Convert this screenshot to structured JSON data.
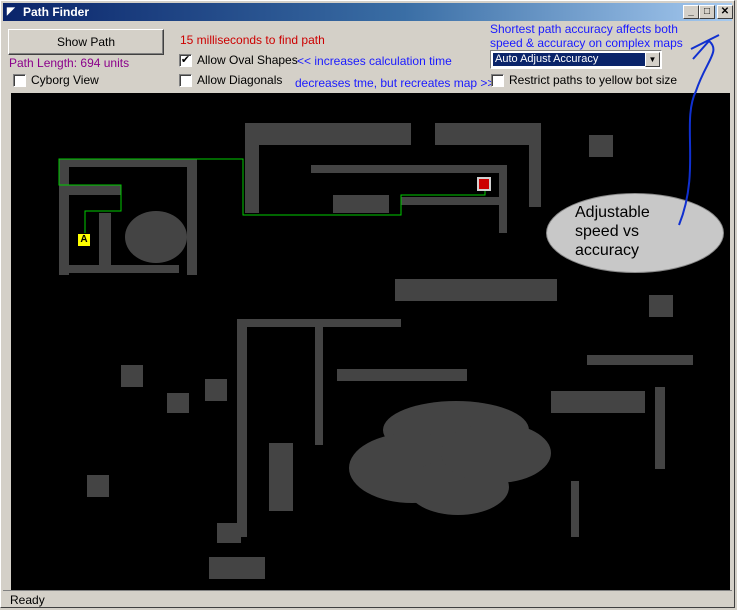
{
  "window": {
    "title": "Path Finder",
    "icon": "app-icon"
  },
  "title_buttons": {
    "minimize": "_",
    "maximize": "□",
    "close": "✕"
  },
  "controls": {
    "show_path_label": "Show Path",
    "path_length": "Path Length: 694 units",
    "cyborg_view_label": "Cyborg View",
    "cyborg_view_checked": false,
    "timing": "15 milliseconds to find path",
    "oval_shapes_label": "Allow Oval Shapes",
    "oval_shapes_checked": true,
    "diagonals_label": "Allow Diagonals",
    "diagonals_checked": false,
    "increases_note": "<< increases calculation time",
    "decreases_note": "decreases tme, but recreates map >>",
    "accuracy_note_line1": "Shortest path accuracy affects both",
    "accuracy_note_line2": "speed & accuracy on complex maps",
    "accuracy_selected": "Auto Adjust Accuracy",
    "restrict_label": "Restrict paths to yellow bot size",
    "restrict_checked": false
  },
  "map": {
    "start_label": "A",
    "start_color": "#ffff00",
    "goal_color": "#cc0000",
    "path_color": "#00cc00",
    "obstacle_color": "#444444",
    "background_color": "#000000"
  },
  "annotation": {
    "text": "Adjustable\nspeed vs\naccuracy",
    "arrow_color": "#1030d0"
  },
  "status": {
    "text": "Ready"
  },
  "colors": {
    "title_start": "#0a246a",
    "title_end": "#a6caf0",
    "face": "#d4d0c8"
  }
}
